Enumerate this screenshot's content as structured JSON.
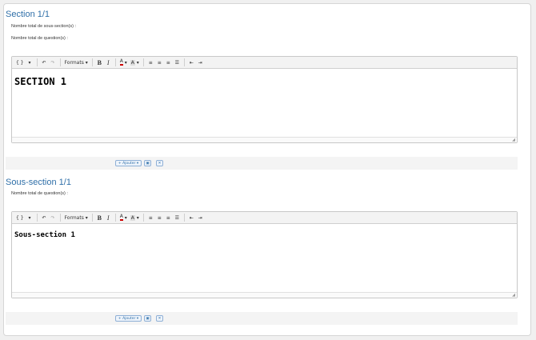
{
  "section": {
    "title": "Section 1/1",
    "meta_subsections": "Nombre total de sous-section(s) :",
    "meta_questions": "Nombre total de question(s) :",
    "editor_content": "SECTION 1"
  },
  "subsection": {
    "title": "Sous-section 1/1",
    "meta_questions": "Nombre total de question(s) :",
    "editor_content": "Sous-section 1"
  },
  "toolbar": {
    "source": "{ }",
    "formats": "Formats",
    "bold": "B",
    "italic": "I",
    "text_color": "A",
    "bg_color": "A",
    "resize_grip": "◢"
  },
  "actions": {
    "add": "+ Ajouter",
    "copy_icon": "copy-icon",
    "delete_icon": "close-icon"
  },
  "colors": {
    "title": "#2f6fa8",
    "button_border": "#8fb0d6"
  }
}
